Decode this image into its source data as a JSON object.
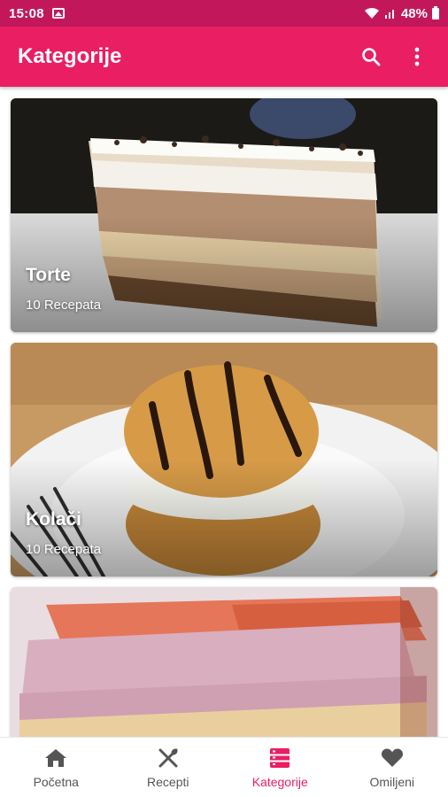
{
  "status_bar": {
    "time": "15:08",
    "battery": "48%"
  },
  "app_bar": {
    "title": "Kategorije"
  },
  "categories": [
    {
      "title": "Torte",
      "count": "10 Recepata"
    },
    {
      "title": "Kolači",
      "count": "10 Recepata"
    },
    {
      "title": "",
      "count": ""
    }
  ],
  "bottom_nav": {
    "items": [
      {
        "label": "Početna",
        "icon": "home-icon"
      },
      {
        "label": "Recepti",
        "icon": "cutlery-icon"
      },
      {
        "label": "Kategorije",
        "icon": "category-icon",
        "active": true
      },
      {
        "label": "Omiljeni",
        "icon": "heart-icon"
      }
    ]
  },
  "colors": {
    "primary": "#e91e63",
    "status_bar": "#c2185b",
    "active_nav": "#e91e63",
    "inactive_nav": "#555555"
  }
}
